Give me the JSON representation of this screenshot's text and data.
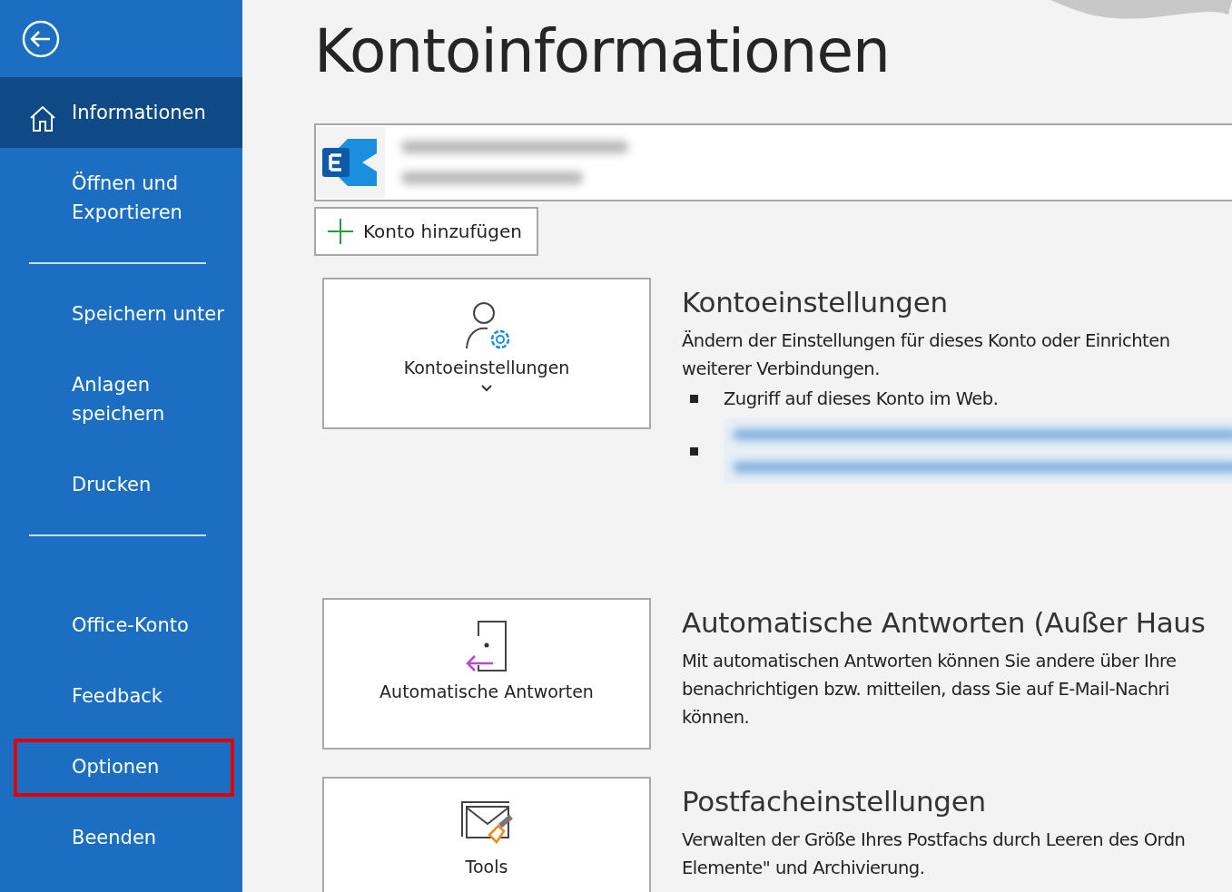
{
  "sidebar": {
    "groups": [
      {
        "items": [
          {
            "label": "Informationen",
            "selected": true,
            "highlighted": false
          },
          {
            "label": "Öffnen und\nExportieren",
            "selected": false,
            "highlighted": false
          }
        ]
      },
      {
        "items": [
          {
            "label": "Speichern unter",
            "selected": false,
            "highlighted": false
          },
          {
            "label": "Anlagen\nspeichern",
            "selected": false,
            "highlighted": false
          },
          {
            "label": "Drucken",
            "selected": false,
            "highlighted": false
          }
        ]
      },
      {
        "items": [
          {
            "label": "Office-Konto",
            "selected": false,
            "highlighted": false
          },
          {
            "label": "Feedback",
            "selected": false,
            "highlighted": false
          },
          {
            "label": "Optionen",
            "selected": false,
            "highlighted": true
          },
          {
            "label": "Beenden",
            "selected": false,
            "highlighted": false
          }
        ]
      }
    ]
  },
  "page": {
    "title": "Kontoinformationen",
    "add_account_button": "Konto hinzufügen",
    "sections": [
      {
        "tile": {
          "label": "Kontoeinstellungen",
          "dropdown": true
        },
        "heading": "Kontoeinstellungen",
        "description": "Ändern der Einstellungen für dieses Konto oder Einrichten\nweiterer Verbindungen.",
        "bullets": [
          {
            "kind": "text",
            "text": "Zugriff auf dieses Konto im Web."
          },
          {
            "kind": "blurred"
          }
        ]
      },
      {
        "tile": {
          "label": "Automatische Antworten",
          "dropdown": false
        },
        "heading": "Automatische Antworten (Außer Haus",
        "description": "Mit automatischen Antworten können Sie andere über Ihre\nbenachrichtigen bzw. mitteilen, dass Sie auf E-Mail-Nachri\nkönnen."
      },
      {
        "tile": {
          "label": "Tools",
          "dropdown": false
        },
        "heading": "Postfacheinstellungen",
        "description": "Verwalten der Größe Ihres Postfachs durch Leeren des Ordn\nElemente\" und Archivierung."
      }
    ]
  }
}
